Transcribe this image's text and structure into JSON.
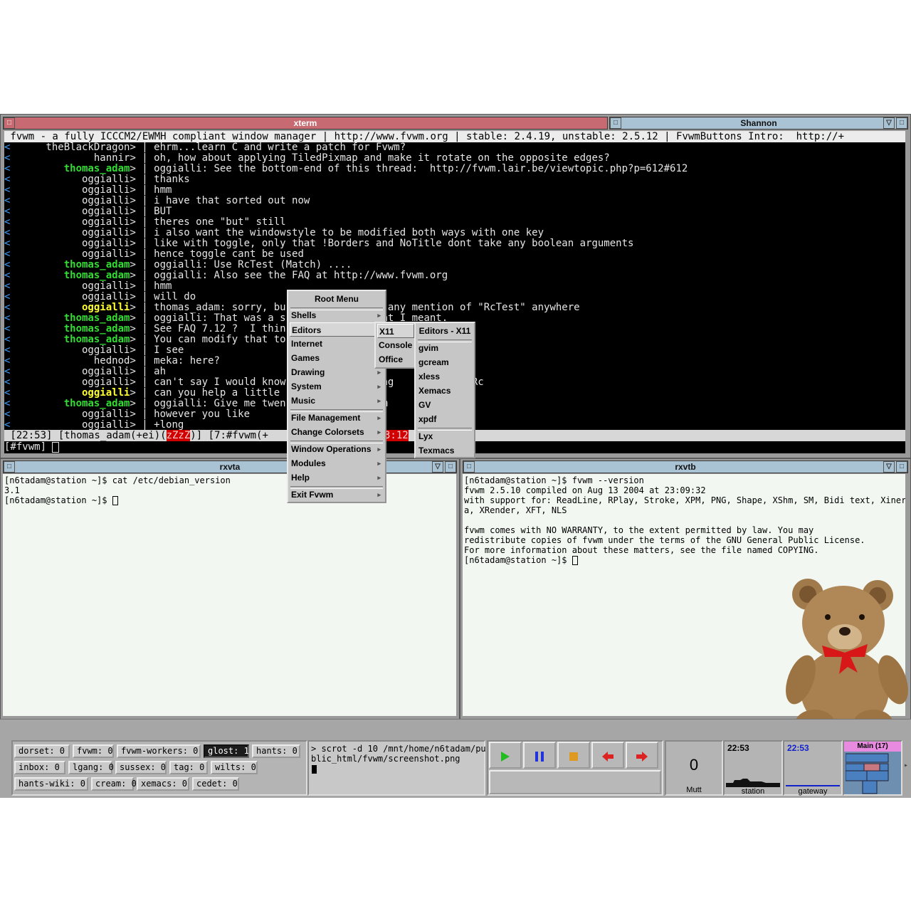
{
  "xterm": {
    "title": "xterm",
    "topic": " fvwm - a fully ICCCM2/EWMH compliant window manager | http://www.fvwm.org | stable: 2.4.19, unstable: 2.5.12 | FvwmButtons Intro:  http://+",
    "lines": [
      {
        "nick": "theBlackDragon",
        "text": "ehrm...learn C and write a patch for Fvwm?",
        "color": "white"
      },
      {
        "nick": "hannir",
        "text": "oh, how about applying TiledPixmap and make it rotate on the opposite edges?",
        "color": "white"
      },
      {
        "nick": "thomas_adam",
        "text": "oggialli: See the bottom-end of this thread:  http://fvwm.lair.be/viewtopic.php?p=612#612",
        "color": "green"
      },
      {
        "nick": "oggialli",
        "text": "thanks",
        "color": "white"
      },
      {
        "nick": "oggialli",
        "text": "hmm",
        "color": "white"
      },
      {
        "nick": "oggialli",
        "text": "i have that sorted out now",
        "color": "white"
      },
      {
        "nick": "oggialli",
        "text": "BUT",
        "color": "white"
      },
      {
        "nick": "oggialli",
        "text": "theres one \"but\" still",
        "color": "white"
      },
      {
        "nick": "oggialli",
        "text": "i also want the windowstyle to be modified both ways with one key",
        "color": "white"
      },
      {
        "nick": "oggialli",
        "text": "like with toggle, only that !Borders and NoTitle dont take any boolean arguments",
        "color": "white"
      },
      {
        "nick": "oggialli",
        "text": "hence toggle cant be used",
        "color": "white"
      },
      {
        "nick": "thomas_adam",
        "text": "oggialli: Use RcTest (Match) ....",
        "color": "green"
      },
      {
        "nick": "thomas_adam",
        "text": "oggialli: Also see the FAQ at http://www.fvwm.org",
        "color": "green"
      },
      {
        "nick": "oggialli",
        "text": "hmm",
        "color": "white"
      },
      {
        "nick": "oggialli",
        "text": "will do",
        "color": "white"
      },
      {
        "nick": "oggialli",
        "text": "thomas_adam: sorry, bu              nd any mention of \"RcTest\" anywhere",
        "color": "yellow"
      },
      {
        "nick": "thomas_adam",
        "text": "oggialli: That was a s              what I meant.",
        "color": "green"
      },
      {
        "nick": "thomas_adam",
        "text": "See FAQ 7.12 ?  I thin",
        "color": "green"
      },
      {
        "nick": "thomas_adam",
        "text": "You can modify that to",
        "color": "green"
      },
      {
        "nick": "oggialli",
        "text": "I see",
        "color": "white"
      },
      {
        "nick": "hednod",
        "text": "meka: here?",
        "color": "white"
      },
      {
        "nick": "oggialli",
        "text": "ah",
        "color": "white"
      },
      {
        "nick": "oggialli",
        "text": "can't say I would know             thing            rRc",
        "color": "white"
      },
      {
        "nick": "oggialli",
        "text": "can you help a little              m ?",
        "color": "yellow"
      },
      {
        "nick": "thomas_adam",
        "text": "oggialli: Give me twen              I'm        ...",
        "color": "green"
      },
      {
        "nick": "oggialli",
        "text": "however you like",
        "color": "white"
      },
      {
        "nick": "oggialli",
        "text": "+long",
        "color": "white"
      }
    ],
    "status_time": " [22:53] [thomas_adam(+ei)(",
    "status_away": "zZzZ",
    "status_rest": ")] [7:#fvwm(+",
    "status_act": "3:12",
    "input_prompt": "[#fvwm] "
  },
  "shannon": {
    "title": "Shannon"
  },
  "rxvta": {
    "title": "rxvta",
    "lines": [
      "[n6tadam@station ~]$ cat /etc/debian_version",
      "3.1",
      "[n6tadam@station ~]$ "
    ]
  },
  "rxvtb": {
    "title": "rxvtb",
    "lines": [
      "[n6tadam@station ~]$ fvwm --version",
      "fvwm 2.5.10 compiled on Aug 13 2004 at 23:09:32",
      "with support for: ReadLine, RPlay, Stroke, XPM, PNG, Shape, XShm, SM, Bidi text, Xineram",
      "a, XRender, XFT, NLS",
      "",
      "fvwm comes with NO WARRANTY, to the extent permitted by law. You may",
      "redistribute copies of fvwm under the terms of the GNU General Public License.",
      "For more information about these matters, see the file named COPYING.",
      "[n6tadam@station ~]$ "
    ]
  },
  "root_menu": {
    "title": "Root Menu",
    "items": [
      "Shells",
      "Editors",
      "Internet",
      "Games",
      "Drawing",
      "System",
      "Music",
      "File Management",
      "Change Colorsets",
      "Window Operations",
      "Modules",
      "Help",
      "Exit Fvwm"
    ]
  },
  "editors_menu": {
    "items": [
      "X11",
      "Console",
      "Office"
    ]
  },
  "x11_menu": {
    "title": "Editors - X11",
    "items": [
      "gvim",
      "gcream",
      "xless",
      "Xemacs",
      "GV",
      "xpdf",
      "Lyx",
      "Texmacs"
    ]
  },
  "panel": {
    "tags": [
      [
        "dorset: 0",
        "fvwm: 0",
        "fvwm-workers: 0",
        "glost: 1",
        "hants: 0"
      ],
      [
        "inbox: 0",
        "lgang: 0",
        "sussex: 0",
        "tag: 0",
        "wilts: 0"
      ],
      [
        "hants-wiki: 0",
        "cream: 0",
        "xemacs: 0",
        "cedet: 0"
      ]
    ],
    "shell_text": "> scrot -d 10 /mnt/home/n6tadam/pu\nblic_html/fvwm/screenshot.png",
    "mutt_count": "0",
    "mutt_label": "Mutt",
    "station_time": "22:53",
    "station_label": "station",
    "gateway_time": "22:53",
    "gateway_label": "gateway",
    "pager_label": "Main (17)"
  },
  "colors": {
    "accent_title": "#c86a72",
    "desk_title": "#a9c2d4",
    "nick_green": "#33dd33",
    "nick_yellow": "#ffff33"
  }
}
